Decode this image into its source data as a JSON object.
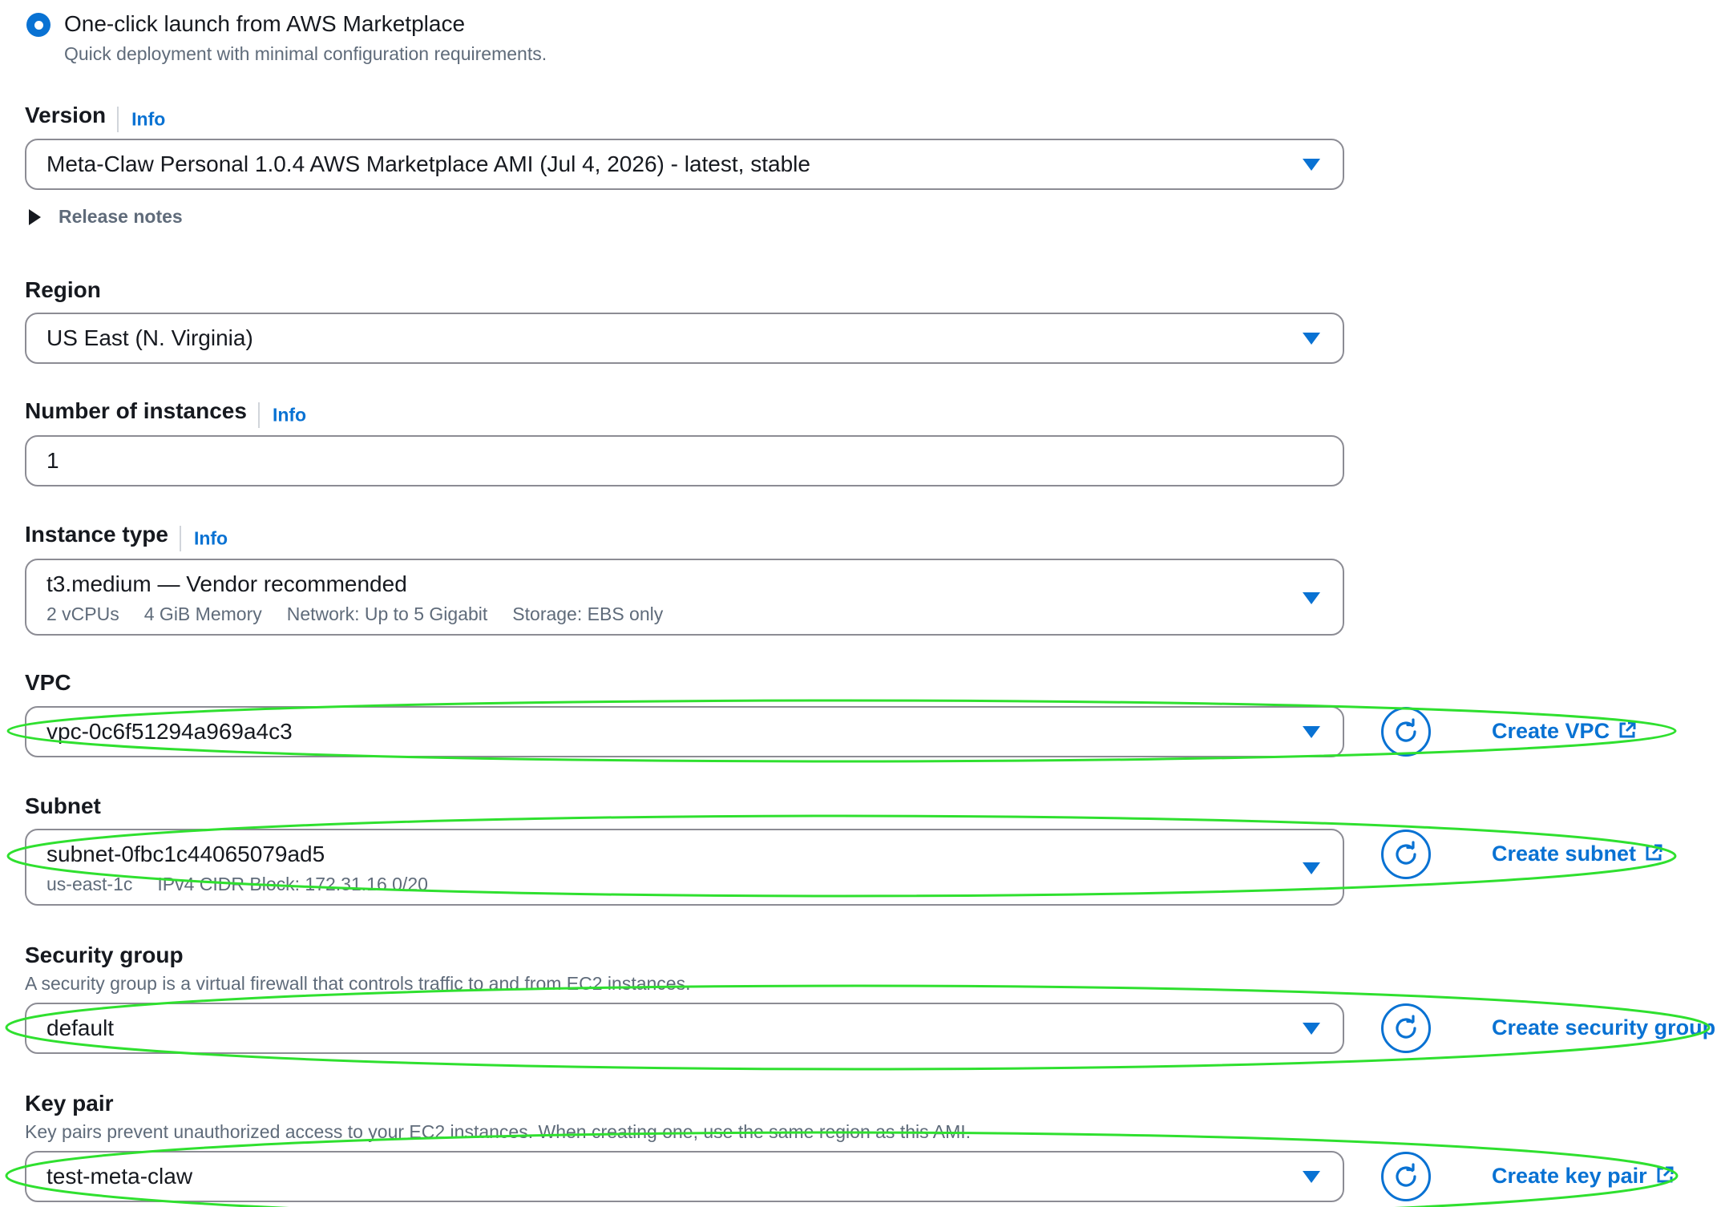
{
  "launch_option": {
    "label": "One-click launch from AWS Marketplace",
    "description": "Quick deployment with minimal configuration requirements."
  },
  "version": {
    "label": "Version",
    "info": "Info",
    "value": "Meta-Claw Personal 1.0.4 AWS Marketplace AMI (Jul 4, 2026) - latest, stable",
    "release_notes": "Release notes"
  },
  "region": {
    "label": "Region",
    "value": "US East (N. Virginia)"
  },
  "instances": {
    "label": "Number of instances",
    "info": "Info",
    "value": "1"
  },
  "instance_type": {
    "label": "Instance type",
    "info": "Info",
    "value": "t3.medium — Vendor recommended",
    "vcpus": "2 vCPUs",
    "memory": "4 GiB Memory",
    "network": "Network: Up to 5 Gigabit",
    "storage": "Storage: EBS only"
  },
  "vpc": {
    "label": "VPC",
    "value": "vpc-0c6f51294a969a4c3",
    "create_label": "Create VPC"
  },
  "subnet": {
    "label": "Subnet",
    "value": "subnet-0fbc1c44065079ad5",
    "zone": "us-east-1c",
    "cidr": "IPv4 CIDR Block: 172.31.16.0/20",
    "create_label": "Create subnet"
  },
  "security_group": {
    "label": "Security group",
    "description": "A security group is a virtual firewall that controls traffic to and from EC2 instances.",
    "value": "default",
    "create_label": "Create security group"
  },
  "key_pair": {
    "label": "Key pair",
    "description": "Key pairs prevent unauthorized access to your EC2 instances. When creating one, use the same region as this AMI.",
    "value": "test-meta-claw",
    "create_label": "Create key pair"
  },
  "colors": {
    "accent": "#0972d3",
    "text": "#16191f",
    "muted": "#5f6b7a",
    "border": "#8c8c94",
    "annotation": "#2fe02f"
  }
}
